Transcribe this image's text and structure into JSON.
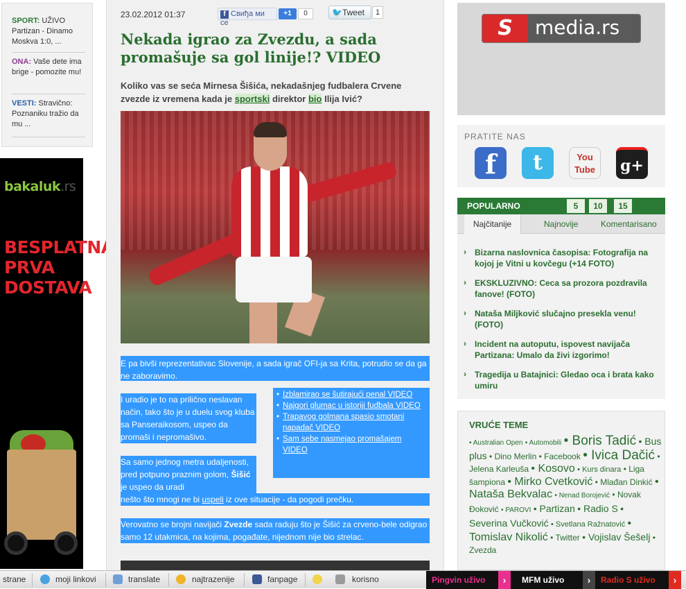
{
  "left_news": [
    {
      "tag": "SPORT:",
      "tag_color": "#2a7a36",
      "text": "UŽIVO Partizan - Dinamo Moskva 1:0, ..."
    },
    {
      "tag": "ONA:",
      "tag_color": "#8e3a8e",
      "text": "Vaše dete ima brige - pomozite mu!"
    },
    {
      "tag": "VESTI:",
      "tag_color": "#2a5fa8",
      "text": "Stravično: Poznaniku tražio da mu ..."
    }
  ],
  "ad_left": {
    "logo": "bakaluk",
    "logo_suffix": ".rs",
    "headline": "BESPLATNA PRVA DOSTAVA"
  },
  "article": {
    "date": "23.02.2012 01:37",
    "fb_like": "Свиђа ми се",
    "fb_count": "0",
    "gplus": "+1",
    "tweet": "Tweet",
    "tweet_count": "1",
    "title": "Nekada igrao za Zvezdu, a sada promašuje sa gol linije!? VIDEO",
    "lead_1": "Koliko vas se seća Mirnesa Šišića, nekadašnjeg fudbalera Crvene zvezde iz vremena kada je ",
    "lead_link1": "sportski",
    "lead_2": " direktor ",
    "lead_link2": "bio",
    "lead_3": " Ilija Ivić?",
    "p1": "E pa bivši reprezentativac Slovenije, a sada igrač OFI-ja sa Krita, potrudio se da ga ne zaboravimo.",
    "p2": "I uradio je to na prilično neslavan način, tako što je u duelu svog kluba sa Panseraikosom, uspeo da promaši i nepromašivo.",
    "p3a": "Sa samo jednog metra udaljenosti, pred potpuno praznim golom, ",
    "p3_bold": "Šišić",
    "p3b": " je uspeo da uradi",
    "p3c": "nešto što mnogi ne bi ",
    "p3_link": "uspeli",
    "p3d": " iz ove situacije - da pogodi prečku.",
    "p4a": "Verovatno se brojni navijači ",
    "p4_bold": "Zvezde",
    "p4b": " sada raduju što je Šišić za crveno-bele odigrao samo 12 utakmica, na kojima, pogađate, nijednom nije bio strelac.",
    "related": [
      "Izblamirao se šutirajući penal VIDEO",
      "Najgori glumac u istoriji fudbala VIDEO",
      "Trapavog golmana spasio smotani napadač VIDEO",
      "Sam sebe nasmejao promašajem VIDEO"
    ]
  },
  "smedia": {
    "s": "S",
    "text": "media.rs"
  },
  "follow": {
    "title": "PRATITE NAS",
    "fb": "f",
    "tw": "t",
    "yt": "You Tube",
    "gp": "g+"
  },
  "popular": {
    "title": "POPULARNO",
    "nums": [
      "5",
      "10",
      "15"
    ],
    "tabs": [
      "Najčitanije",
      "Najnovije",
      "Komentarisano"
    ],
    "items": [
      "Bizarna naslovnica časopisa: Fotografija na kojoj je Vitni u kovčegu (+14 FOTO)",
      "EKSKLUZIVNO: Ceca sa prozora pozdravila fanove! (FOTO)",
      "Nataša Miljković slučajno presekla venu! (FOTO)",
      "Incident na autoputu, ispovest navijača Partizana: Umalo da živi izgorimo!",
      "Tragedija u Batajnici: Gledao oca i brata kako umiru"
    ],
    "arrow": "›"
  },
  "hot": {
    "title": "VRUĆE TEME",
    "tags": [
      {
        "t": "Australian Open",
        "s": "t1"
      },
      {
        "t": "Automobili",
        "s": "t1"
      },
      {
        "t": "Boris Tadić",
        "s": "t6"
      },
      {
        "t": "Bus plus",
        "s": "t4"
      },
      {
        "t": "Dino Merlin",
        "s": "t3"
      },
      {
        "t": "Facebook",
        "s": "t3"
      },
      {
        "t": "Ivica Dačić",
        "s": "t6"
      },
      {
        "t": "Jelena Karleuša",
        "s": "t3"
      },
      {
        "t": "Kosovo",
        "s": "t5"
      },
      {
        "t": "Kurs dinara",
        "s": "t2"
      },
      {
        "t": "Liga šampiona",
        "s": "t3"
      },
      {
        "t": "Mirko Cvetković",
        "s": "t5"
      },
      {
        "t": "Mlađan Dinkić",
        "s": "t3"
      },
      {
        "t": "Nataša Bekvalac",
        "s": "t5"
      },
      {
        "t": "Nenad Borojević",
        "s": "t1"
      },
      {
        "t": "Novak Đoković",
        "s": "t3"
      },
      {
        "t": "PAROVI",
        "s": "t1"
      },
      {
        "t": "Partizan",
        "s": "t4"
      },
      {
        "t": "Radio S",
        "s": "t4"
      },
      {
        "t": "Severina Vučković",
        "s": "t4"
      },
      {
        "t": "Svetlana Ražnatović",
        "s": "t2"
      },
      {
        "t": "Tomislav Nikolić",
        "s": "t5"
      },
      {
        "t": "Twitter",
        "s": "t3"
      },
      {
        "t": "Vojislav Šešelj",
        "s": "t4"
      },
      {
        "t": "Zvezda",
        "s": "t3"
      }
    ]
  },
  "toolbar": {
    "strane": "strane",
    "moji_linkovi": "moji linkovi",
    "translate": "translate",
    "najtrazenije": "najtrazenije",
    "fanpage": "fanpage",
    "korisno": "korisno",
    "pingvin": "Pingvin uživo",
    "mfm": "MFM uživo",
    "radio": "Radio S uživo",
    "arrow": "›"
  }
}
